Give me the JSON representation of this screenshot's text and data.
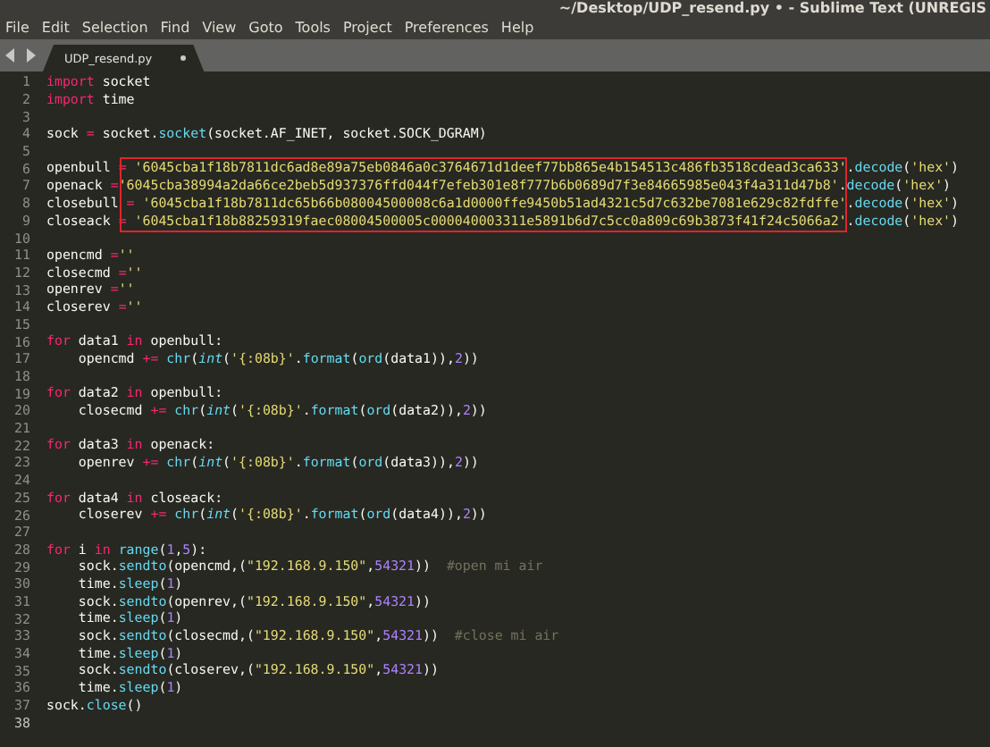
{
  "window": {
    "title": "~/Desktop/UDP_resend.py • - Sublime Text (UNREGIS"
  },
  "menu": [
    "File",
    "Edit",
    "Selection",
    "Find",
    "View",
    "Goto",
    "Tools",
    "Project",
    "Preferences",
    "Help"
  ],
  "tabs": [
    {
      "label": "UDP_resend.py",
      "selected": true,
      "modified": true
    }
  ],
  "editor": {
    "lines": [
      {
        "number": "1",
        "tokens": [
          {
            "kind": "kw",
            "text": "import"
          },
          {
            "kind": "pl",
            "text": " socket"
          }
        ]
      },
      {
        "number": "2",
        "tokens": [
          {
            "kind": "kw",
            "text": "import"
          },
          {
            "kind": "pl",
            "text": " time"
          }
        ]
      },
      {
        "number": "3"
      },
      {
        "number": "4",
        "tokens": [
          {
            "kind": "pl",
            "text": "sock "
          },
          {
            "kind": "kw",
            "text": "="
          },
          {
            "kind": "pl",
            "text": " socket."
          },
          {
            "kind": "fn",
            "text": "socket"
          },
          {
            "kind": "pl",
            "text": "(socket.AF_INET, socket.SOCK_DGRAM)"
          }
        ]
      },
      {
        "number": "5"
      },
      {
        "number": "6",
        "tokens": [
          {
            "kind": "pl",
            "text": "openbull "
          },
          {
            "kind": "kw",
            "text": "="
          },
          {
            "kind": "str",
            "text": " '6045cba1f18b7811dc6ad8e89a75eb0846a0c3764671d1deef77bb865e4b154513c486fb3518cdead3ca633'"
          },
          {
            "kind": "pl",
            "text": "."
          },
          {
            "kind": "fn",
            "text": "decode"
          },
          {
            "kind": "pl",
            "text": "("
          },
          {
            "kind": "str",
            "text": "'hex'"
          },
          {
            "kind": "pl",
            "text": ")"
          }
        ]
      },
      {
        "number": "7",
        "tokens": [
          {
            "kind": "pl",
            "text": "openack "
          },
          {
            "kind": "kw",
            "text": "="
          },
          {
            "kind": "str",
            "text": "'6045cba38994a2da66ce2beb5d937376ffd044f7efeb301e8f777b6b0689d7f3e84665985e043f4a311d47b8'"
          },
          {
            "kind": "pl",
            "text": "."
          },
          {
            "kind": "fn",
            "text": "decode"
          },
          {
            "kind": "pl",
            "text": "("
          },
          {
            "kind": "str",
            "text": "'hex'"
          },
          {
            "kind": "pl",
            "text": ")"
          }
        ]
      },
      {
        "number": "8",
        "tokens": [
          {
            "kind": "pl",
            "text": "closebull "
          },
          {
            "kind": "kw",
            "text": "="
          },
          {
            "kind": "str",
            "text": " '6045cba1f18b7811dc65b66b08004500008c6a1d0000ffe9450b51ad4321c5d7c632be7081e629c82fdffe'"
          },
          {
            "kind": "pl",
            "text": "."
          },
          {
            "kind": "fn",
            "text": "decode"
          },
          {
            "kind": "pl",
            "text": "("
          },
          {
            "kind": "str",
            "text": "'hex'"
          },
          {
            "kind": "pl",
            "text": ")"
          }
        ]
      },
      {
        "number": "9",
        "tokens": [
          {
            "kind": "pl",
            "text": "closeack "
          },
          {
            "kind": "kw",
            "text": "="
          },
          {
            "kind": "str",
            "text": " '6045cba1f18b88259319faec08004500005c000040003311e5891b6d7c5cc0a809c69b3873f41f24c5066a2'"
          },
          {
            "kind": "pl",
            "text": "."
          },
          {
            "kind": "fn",
            "text": "decode"
          },
          {
            "kind": "pl",
            "text": "("
          },
          {
            "kind": "str",
            "text": "'hex'"
          },
          {
            "kind": "pl",
            "text": ")"
          }
        ]
      },
      {
        "number": "10"
      },
      {
        "number": "11",
        "tokens": [
          {
            "kind": "pl",
            "text": "opencmd "
          },
          {
            "kind": "kw",
            "text": "="
          },
          {
            "kind": "str",
            "text": "''"
          }
        ]
      },
      {
        "number": "12",
        "tokens": [
          {
            "kind": "pl",
            "text": "closecmd "
          },
          {
            "kind": "kw",
            "text": "="
          },
          {
            "kind": "str",
            "text": "''"
          }
        ]
      },
      {
        "number": "13",
        "tokens": [
          {
            "kind": "pl",
            "text": "openrev "
          },
          {
            "kind": "kw",
            "text": "="
          },
          {
            "kind": "str",
            "text": "''"
          }
        ]
      },
      {
        "number": "14",
        "tokens": [
          {
            "kind": "pl",
            "text": "closerev "
          },
          {
            "kind": "kw",
            "text": "="
          },
          {
            "kind": "str",
            "text": "''"
          }
        ]
      },
      {
        "number": "15"
      },
      {
        "number": "16",
        "tokens": [
          {
            "kind": "kw",
            "text": "for"
          },
          {
            "kind": "pl",
            "text": " data1 "
          },
          {
            "kind": "kw",
            "text": "in"
          },
          {
            "kind": "pl",
            "text": " openbull:"
          }
        ]
      },
      {
        "number": "17",
        "tokens": [
          {
            "kind": "pl",
            "text": "    opencmd "
          },
          {
            "kind": "kw",
            "text": "+="
          },
          {
            "kind": "fn",
            "text": " chr"
          },
          {
            "kind": "pl",
            "text": "("
          },
          {
            "kind": "it",
            "text": "int"
          },
          {
            "kind": "pl",
            "text": "("
          },
          {
            "kind": "str",
            "text": "'{:08b}'"
          },
          {
            "kind": "pl",
            "text": "."
          },
          {
            "kind": "fn",
            "text": "format"
          },
          {
            "kind": "pl",
            "text": "("
          },
          {
            "kind": "fn",
            "text": "ord"
          },
          {
            "kind": "pl",
            "text": "(data1)),"
          },
          {
            "kind": "num",
            "text": "2"
          },
          {
            "kind": "pl",
            "text": "))"
          }
        ]
      },
      {
        "number": "18"
      },
      {
        "number": "19",
        "tokens": [
          {
            "kind": "kw",
            "text": "for"
          },
          {
            "kind": "pl",
            "text": " data2 "
          },
          {
            "kind": "kw",
            "text": "in"
          },
          {
            "kind": "pl",
            "text": " openbull:"
          }
        ]
      },
      {
        "number": "20",
        "tokens": [
          {
            "kind": "pl",
            "text": "    closecmd "
          },
          {
            "kind": "kw",
            "text": "+="
          },
          {
            "kind": "fn",
            "text": " chr"
          },
          {
            "kind": "pl",
            "text": "("
          },
          {
            "kind": "it",
            "text": "int"
          },
          {
            "kind": "pl",
            "text": "("
          },
          {
            "kind": "str",
            "text": "'{:08b}'"
          },
          {
            "kind": "pl",
            "text": "."
          },
          {
            "kind": "fn",
            "text": "format"
          },
          {
            "kind": "pl",
            "text": "("
          },
          {
            "kind": "fn",
            "text": "ord"
          },
          {
            "kind": "pl",
            "text": "(data2)),"
          },
          {
            "kind": "num",
            "text": "2"
          },
          {
            "kind": "pl",
            "text": "))"
          }
        ]
      },
      {
        "number": "21"
      },
      {
        "number": "22",
        "tokens": [
          {
            "kind": "kw",
            "text": "for"
          },
          {
            "kind": "pl",
            "text": " data3 "
          },
          {
            "kind": "kw",
            "text": "in"
          },
          {
            "kind": "pl",
            "text": " openack:"
          }
        ]
      },
      {
        "number": "23",
        "tokens": [
          {
            "kind": "pl",
            "text": "    openrev "
          },
          {
            "kind": "kw",
            "text": "+="
          },
          {
            "kind": "fn",
            "text": " chr"
          },
          {
            "kind": "pl",
            "text": "("
          },
          {
            "kind": "it",
            "text": "int"
          },
          {
            "kind": "pl",
            "text": "("
          },
          {
            "kind": "str",
            "text": "'{:08b}'"
          },
          {
            "kind": "pl",
            "text": "."
          },
          {
            "kind": "fn",
            "text": "format"
          },
          {
            "kind": "pl",
            "text": "("
          },
          {
            "kind": "fn",
            "text": "ord"
          },
          {
            "kind": "pl",
            "text": "(data3)),"
          },
          {
            "kind": "num",
            "text": "2"
          },
          {
            "kind": "pl",
            "text": "))"
          }
        ]
      },
      {
        "number": "24"
      },
      {
        "number": "25",
        "tokens": [
          {
            "kind": "kw",
            "text": "for"
          },
          {
            "kind": "pl",
            "text": " data4 "
          },
          {
            "kind": "kw",
            "text": "in"
          },
          {
            "kind": "pl",
            "text": " closeack:"
          }
        ]
      },
      {
        "number": "26",
        "tokens": [
          {
            "kind": "pl",
            "text": "    closerev "
          },
          {
            "kind": "kw",
            "text": "+="
          },
          {
            "kind": "fn",
            "text": " chr"
          },
          {
            "kind": "pl",
            "text": "("
          },
          {
            "kind": "it",
            "text": "int"
          },
          {
            "kind": "pl",
            "text": "("
          },
          {
            "kind": "str",
            "text": "'{:08b}'"
          },
          {
            "kind": "pl",
            "text": "."
          },
          {
            "kind": "fn",
            "text": "format"
          },
          {
            "kind": "pl",
            "text": "("
          },
          {
            "kind": "fn",
            "text": "ord"
          },
          {
            "kind": "pl",
            "text": "(data4)),"
          },
          {
            "kind": "num",
            "text": "2"
          },
          {
            "kind": "pl",
            "text": "))"
          }
        ]
      },
      {
        "number": "27"
      },
      {
        "number": "28",
        "tokens": [
          {
            "kind": "kw",
            "text": "for"
          },
          {
            "kind": "pl",
            "text": " i "
          },
          {
            "kind": "kw",
            "text": "in"
          },
          {
            "kind": "fn",
            "text": " range"
          },
          {
            "kind": "pl",
            "text": "("
          },
          {
            "kind": "num",
            "text": "1"
          },
          {
            "kind": "pl",
            "text": ","
          },
          {
            "kind": "num",
            "text": "5"
          },
          {
            "kind": "pl",
            "text": "):"
          }
        ]
      },
      {
        "number": "29",
        "tokens": [
          {
            "kind": "pl",
            "text": "    sock."
          },
          {
            "kind": "fn",
            "text": "sendto"
          },
          {
            "kind": "pl",
            "text": "(opencmd,("
          },
          {
            "kind": "str",
            "text": "\"192.168.9.150\""
          },
          {
            "kind": "pl",
            "text": ","
          },
          {
            "kind": "num",
            "text": "54321"
          },
          {
            "kind": "pl",
            "text": "))"
          },
          {
            "kind": "cm",
            "text": "  #open mi air"
          }
        ]
      },
      {
        "number": "30",
        "tokens": [
          {
            "kind": "pl",
            "text": "    time."
          },
          {
            "kind": "fn",
            "text": "sleep"
          },
          {
            "kind": "pl",
            "text": "("
          },
          {
            "kind": "num",
            "text": "1"
          },
          {
            "kind": "pl",
            "text": ")"
          }
        ]
      },
      {
        "number": "31",
        "tokens": [
          {
            "kind": "pl",
            "text": "    sock."
          },
          {
            "kind": "fn",
            "text": "sendto"
          },
          {
            "kind": "pl",
            "text": "(openrev,("
          },
          {
            "kind": "str",
            "text": "\"192.168.9.150\""
          },
          {
            "kind": "pl",
            "text": ","
          },
          {
            "kind": "num",
            "text": "54321"
          },
          {
            "kind": "pl",
            "text": "))"
          }
        ]
      },
      {
        "number": "32",
        "tokens": [
          {
            "kind": "pl",
            "text": "    time."
          },
          {
            "kind": "fn",
            "text": "sleep"
          },
          {
            "kind": "pl",
            "text": "("
          },
          {
            "kind": "num",
            "text": "1"
          },
          {
            "kind": "pl",
            "text": ")"
          }
        ]
      },
      {
        "number": "33",
        "tokens": [
          {
            "kind": "pl",
            "text": "    sock."
          },
          {
            "kind": "fn",
            "text": "sendto"
          },
          {
            "kind": "pl",
            "text": "(closecmd,("
          },
          {
            "kind": "str",
            "text": "\"192.168.9.150\""
          },
          {
            "kind": "pl",
            "text": ","
          },
          {
            "kind": "num",
            "text": "54321"
          },
          {
            "kind": "pl",
            "text": "))"
          },
          {
            "kind": "cm",
            "text": "  #close mi air"
          }
        ]
      },
      {
        "number": "34",
        "tokens": [
          {
            "kind": "pl",
            "text": "    time."
          },
          {
            "kind": "fn",
            "text": "sleep"
          },
          {
            "kind": "pl",
            "text": "("
          },
          {
            "kind": "num",
            "text": "1"
          },
          {
            "kind": "pl",
            "text": ")"
          }
        ]
      },
      {
        "number": "35",
        "tokens": [
          {
            "kind": "pl",
            "text": "    sock."
          },
          {
            "kind": "fn",
            "text": "sendto"
          },
          {
            "kind": "pl",
            "text": "(closerev,("
          },
          {
            "kind": "str",
            "text": "\"192.168.9.150\""
          },
          {
            "kind": "pl",
            "text": ","
          },
          {
            "kind": "num",
            "text": "54321"
          },
          {
            "kind": "pl",
            "text": "))"
          }
        ]
      },
      {
        "number": "36",
        "tokens": [
          {
            "kind": "pl",
            "text": "    time."
          },
          {
            "kind": "fn",
            "text": "sleep"
          },
          {
            "kind": "pl",
            "text": "("
          },
          {
            "kind": "num",
            "text": "1"
          },
          {
            "kind": "pl",
            "text": ")"
          }
        ]
      },
      {
        "number": "37",
        "tokens": [
          {
            "kind": "pl",
            "text": "sock."
          },
          {
            "kind": "fn",
            "text": "close"
          },
          {
            "kind": "pl",
            "text": "()"
          }
        ]
      },
      {
        "number": "38"
      }
    ]
  }
}
